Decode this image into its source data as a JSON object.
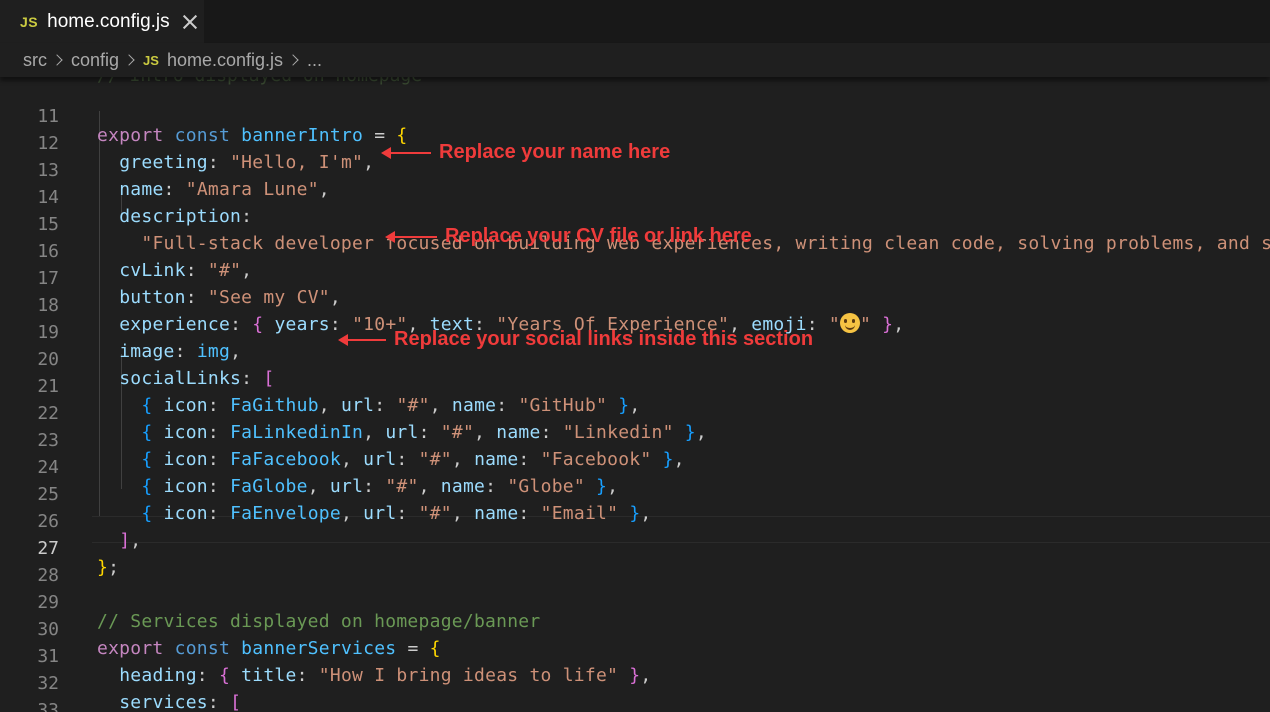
{
  "tab": {
    "badge": "JS",
    "filename": "home.config.js"
  },
  "breadcrumb": {
    "items": [
      "src",
      "config"
    ],
    "file_badge": "JS",
    "file": "home.config.js",
    "more": "..."
  },
  "editor": {
    "ghost_comment": "// Intro displayed on homepage",
    "current_line": 27,
    "lines": [
      {
        "n": "11"
      },
      {
        "n": "12"
      },
      {
        "n": "13"
      },
      {
        "n": "14"
      },
      {
        "n": "15"
      },
      {
        "n": "16"
      },
      {
        "n": "17"
      },
      {
        "n": "18"
      },
      {
        "n": "19"
      },
      {
        "n": "20"
      },
      {
        "n": "21"
      },
      {
        "n": "22"
      },
      {
        "n": "23"
      },
      {
        "n": "24"
      },
      {
        "n": "25"
      },
      {
        "n": "26"
      },
      {
        "n": "27"
      },
      {
        "n": "28"
      },
      {
        "n": "29"
      },
      {
        "n": "30"
      },
      {
        "n": "31"
      },
      {
        "n": "32"
      },
      {
        "n": "33"
      }
    ],
    "code": {
      "l11": [
        "export",
        "const",
        "bannerIntro",
        "=",
        "{"
      ],
      "l12": [
        "greeting",
        "\"Hello, I'm\""
      ],
      "l13": [
        "name",
        "\"Amara Lune\""
      ],
      "l14": [
        "description"
      ],
      "l15": [
        "\"Full-stack developer focused on building web experiences, writing clean code, solving problems, and st"
      ],
      "l16": [
        "cvLink",
        "\"#\""
      ],
      "l17": [
        "button",
        "\"See my CV\""
      ],
      "l18": [
        "experience",
        "years",
        "\"10+\"",
        "text",
        "\"Years Of Experience\"",
        "emoji"
      ],
      "l19": [
        "image",
        "img"
      ],
      "l20": [
        "socialLinks"
      ],
      "social": [
        {
          "icon": "FaGithub",
          "url": "\"#\"",
          "name": "\"GitHub\""
        },
        {
          "icon": "FaLinkedinIn",
          "url": "\"#\"",
          "name": "\"Linkedin\""
        },
        {
          "icon": "FaFacebook",
          "url": "\"#\"",
          "name": "\"Facebook\""
        },
        {
          "icon": "FaGlobe",
          "url": "\"#\"",
          "name": "\"Globe\""
        },
        {
          "icon": "FaEnvelope",
          "url": "\"#\"",
          "name": "\"Email\""
        }
      ],
      "l29": "// Services displayed on homepage/banner",
      "l30": [
        "export",
        "const",
        "bannerServices",
        "=",
        "{"
      ],
      "l31": [
        "heading",
        "title",
        "\"How I bring ideas to life\""
      ],
      "l32": [
        "services"
      ]
    }
  },
  "annotations": {
    "name": "Replace your name here",
    "cv": "Replace your CV file or link here",
    "social": "Replace your social links inside this section"
  },
  "colors": {
    "annotation": "#ef3b3b",
    "keyword": "#569cd6",
    "string": "#ce9178",
    "property": "#9cdcfe"
  }
}
